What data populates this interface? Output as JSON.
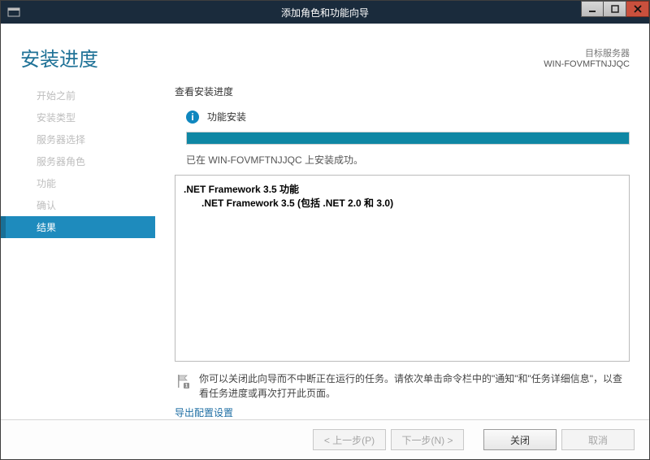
{
  "window": {
    "title": "添加角色和功能向导"
  },
  "header": {
    "heading": "安装进度",
    "target_label": "目标服务器",
    "target_server": "WIN-FOVMFTNJJQC"
  },
  "sidebar": {
    "items": [
      {
        "label": "开始之前",
        "active": false
      },
      {
        "label": "安装类型",
        "active": false
      },
      {
        "label": "服务器选择",
        "active": false
      },
      {
        "label": "服务器角色",
        "active": false
      },
      {
        "label": "功能",
        "active": false
      },
      {
        "label": "确认",
        "active": false
      },
      {
        "label": "结果",
        "active": true
      }
    ]
  },
  "content": {
    "section_title": "查看安装进度",
    "status_text": "功能安装",
    "progress_percent": 100,
    "progress_message": "已在 WIN-FOVMFTNJJQC 上安装成功。",
    "features": {
      "line1": ".NET Framework 3.5 功能",
      "line2": ".NET Framework 3.5 (包括 .NET 2.0 和 3.0)"
    },
    "note_text": "你可以关闭此向导而不中断正在运行的任务。请依次单击命令栏中的\"通知\"和\"任务详细信息\"，以查看任务进度或再次打开此页面。",
    "export_link": "导出配置设置"
  },
  "footer": {
    "prev": "< 上一步(P)",
    "next": "下一步(N) >",
    "close": "关闭",
    "cancel": "取消"
  },
  "colors": {
    "accent": "#1e8bbd",
    "heading": "#1f7297"
  }
}
